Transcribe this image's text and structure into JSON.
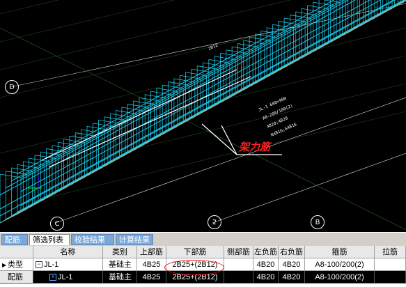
{
  "viewport": {
    "axis_labels": [
      "D",
      "C",
      "2",
      "B"
    ],
    "annotation": "架力筋",
    "beam_tag_lines": [
      "JL-1 600×900",
      "A8-200/100(2)",
      "4B20;4B20",
      "N4B16;G4B16"
    ],
    "small_tag": "2B12"
  },
  "tabs": [
    "配筋",
    "筛选列表",
    "校验结果",
    "计算结果"
  ],
  "active_tab": 1,
  "table": {
    "headers": [
      "",
      "名称",
      "类别",
      "上部筋",
      "下部筋",
      "侧部筋",
      "左负筋",
      "右负筋",
      "箍筋",
      "拉筋"
    ],
    "rows": [
      {
        "head": "类型",
        "marker": "▶",
        "tree": "−",
        "name": "JL-1",
        "category": "基础主",
        "top": "4B25",
        "bottom": "2B25+(2B12)",
        "side": "",
        "left_neg": "4B20",
        "right_neg": "4B20",
        "stirrup": "A8-100/200(2)",
        "tie": ""
      },
      {
        "head": "配筋",
        "marker": "",
        "tree": "+",
        "name": "JL-1",
        "category": "基础主",
        "top": "4B25",
        "bottom": "2B25+(2B12)",
        "side": "",
        "left_neg": "4B20",
        "right_neg": "4B20",
        "stirrup": "A8-100/200(2)",
        "tie": ""
      }
    ]
  },
  "colors": {
    "cyan": "#19c6e6",
    "annotation_red": "#ff2020",
    "tab_blue": "#7aa8d8"
  }
}
